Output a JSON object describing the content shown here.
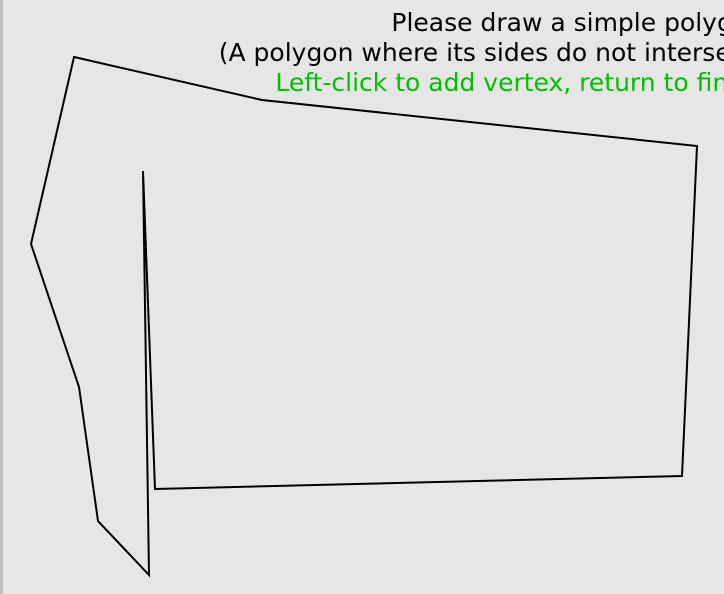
{
  "instructions": {
    "line1": "Please draw a simple polygon",
    "line2": "(A polygon where its sides do not intersect)",
    "line3": "Left-click to add vertex, return to finish"
  },
  "colors": {
    "background": "#e6e6e6",
    "text": "#000000",
    "hint_text": "#00c000",
    "polygon_stroke": "#000000"
  }
}
